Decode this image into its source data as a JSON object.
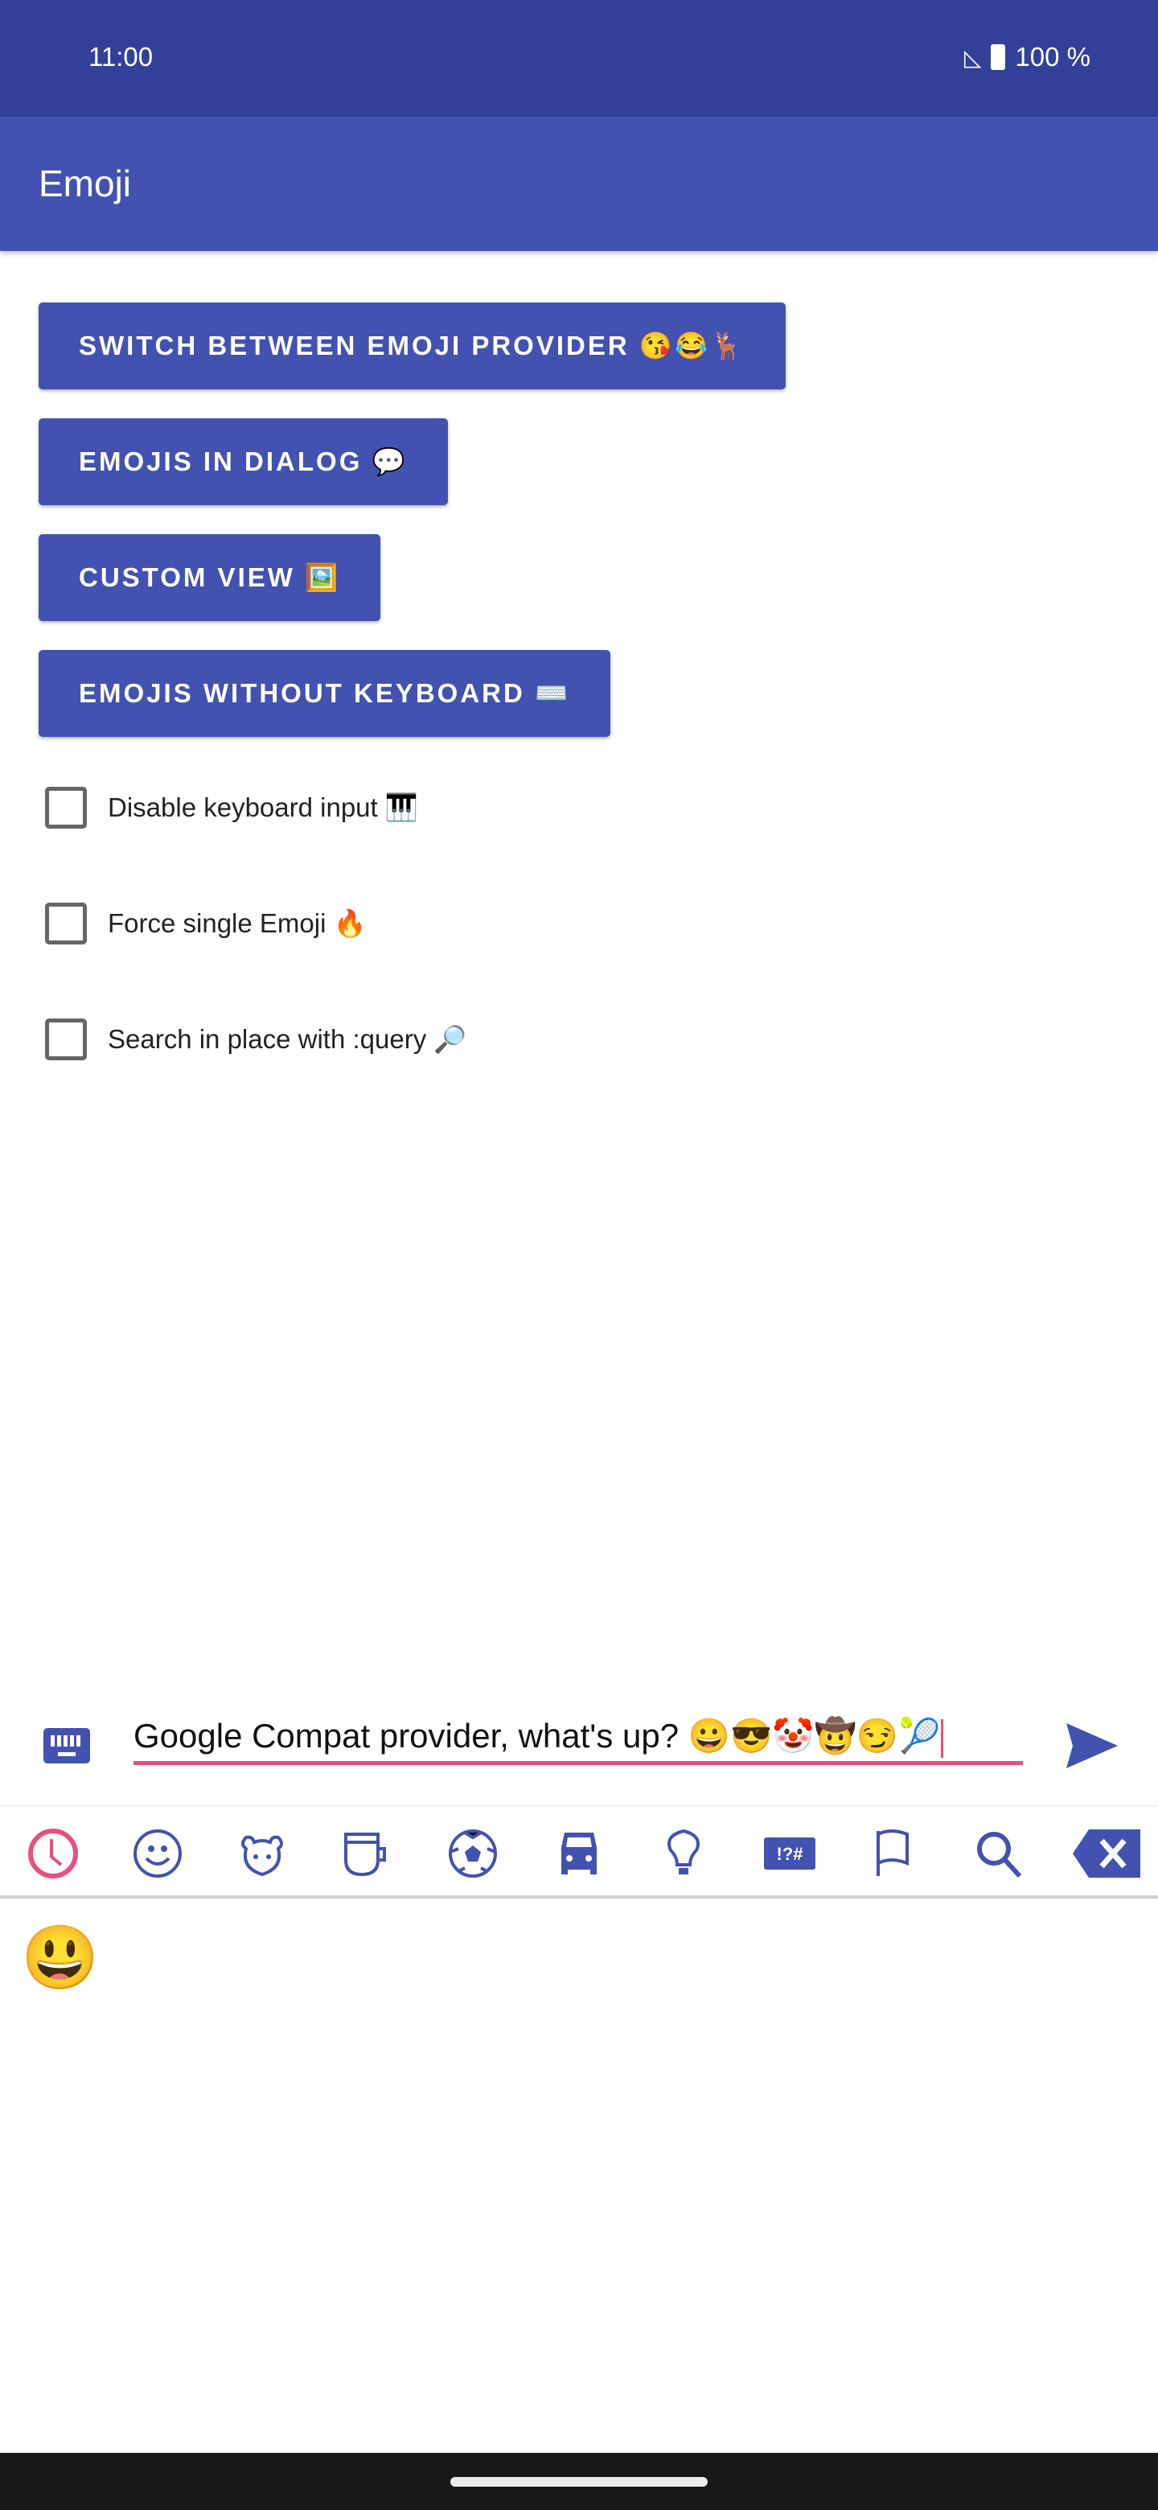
{
  "status_bar": {
    "time": "11:00",
    "battery": "100 %"
  },
  "app_bar": {
    "title": "Emoji"
  },
  "buttons": [
    {
      "label": "SWITCH BETWEEN EMOJI PROVIDER 😘😂🦌"
    },
    {
      "label": "EMOJIS IN DIALOG 💬"
    },
    {
      "label": "CUSTOM VIEW 🖼️"
    },
    {
      "label": "EMOJIS WITHOUT KEYBOARD ⌨️"
    }
  ],
  "checkboxes": [
    {
      "label": "Disable keyboard input 🎹",
      "checked": false
    },
    {
      "label": "Force single Emoji 🔥",
      "checked": false
    },
    {
      "label": "Search in place with :query 🔎",
      "checked": false
    }
  ],
  "input": {
    "value": "Google Compat provider, what's up? 😀😎🤡🤠😏🎾"
  },
  "categories": [
    "recent-icon",
    "smileys-icon",
    "animals-icon",
    "food-icon",
    "activities-icon",
    "travel-icon",
    "objects-icon",
    "symbols-icon",
    "flags-icon",
    "search-icon",
    "backspace-icon"
  ],
  "recent_emojis": [
    "😃"
  ],
  "colors": {
    "primary": "#4351b0",
    "primary_dark": "#32409a",
    "accent": "#e8507c"
  }
}
